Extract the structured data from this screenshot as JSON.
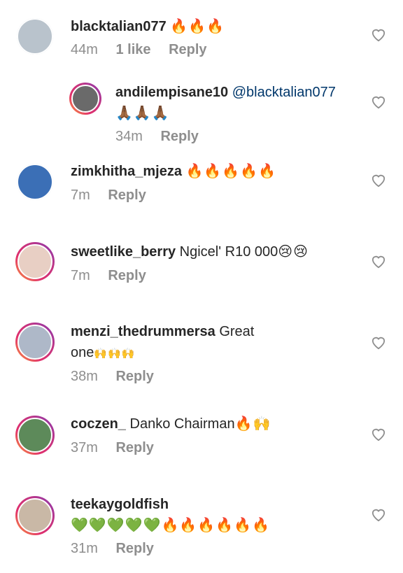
{
  "comments": [
    {
      "username": "blacktalian077",
      "text": "",
      "emoji": "🔥🔥🔥",
      "time": "44m",
      "likes": "1 like",
      "reply": "Reply"
    },
    {
      "username": "andilempisane10",
      "mention": "@blacktalian077",
      "emoji": "🙏🏾🙏🏾🙏🏾",
      "time": "34m",
      "reply": "Reply"
    },
    {
      "username": "zimkhitha_mjeza",
      "text": "",
      "emoji": "🔥🔥🔥🔥🔥",
      "time": "7m",
      "reply": "Reply"
    },
    {
      "username": "sweetlike_berry",
      "text": "Ngicel' R10 000",
      "emoji": "😢😢",
      "time": "7m",
      "reply": "Reply"
    },
    {
      "username": "menzi_thedrummersa",
      "text": "Great",
      "text2": "one",
      "emoji": "🙌🙌🙌",
      "time": "38m",
      "reply": "Reply"
    },
    {
      "username": "coczen_",
      "text": "Danko Chairman",
      "emoji": "🔥🙌",
      "time": "37m",
      "reply": "Reply"
    },
    {
      "username": "teekaygoldfish",
      "text": "",
      "emoji": "💚💚💚💚💚🔥🔥🔥🔥🔥🔥",
      "time": "31m",
      "reply": "Reply"
    }
  ],
  "icons": {
    "like": "heart-outline-icon"
  },
  "colors": {
    "username": "#262626",
    "meta": "#8e8e8e",
    "mention": "#00376b",
    "heart": "#8e8e8e"
  }
}
